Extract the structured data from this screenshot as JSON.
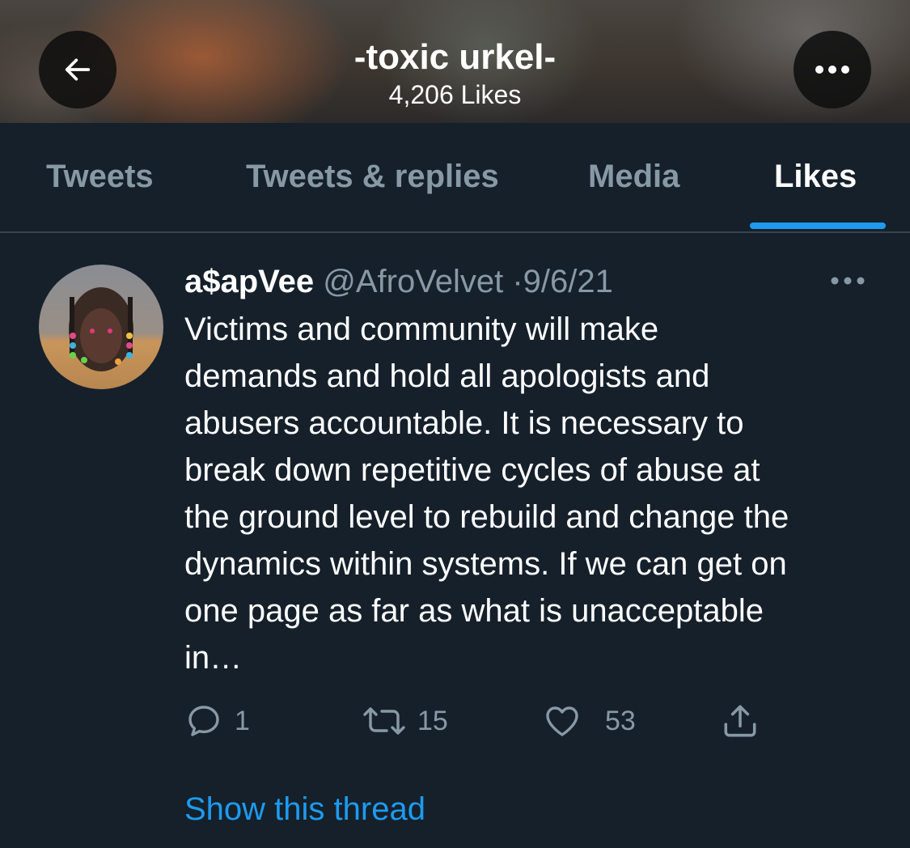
{
  "header": {
    "title": "-toxic urkel-",
    "subtitle": "4,206 Likes",
    "back_icon": "arrow-left-icon",
    "more_icon": "more-horizontal-icon"
  },
  "tabs": [
    {
      "label": "Tweets",
      "active": false
    },
    {
      "label": "Tweets & replies",
      "active": false
    },
    {
      "label": "Media",
      "active": false
    },
    {
      "label": "Likes",
      "active": true
    }
  ],
  "tweet": {
    "author_name": "a$apVee",
    "author_handle": "@AfroVelvet",
    "separator": "·",
    "date": "9/6/21",
    "text": "Victims and community will make\ndemands and hold all apologists and\nabusers accountable. It is necessary to\nbreak down repetitive cycles of abuse at\nthe ground level to rebuild and change the\ndynamics within systems. If we can get on\none page as far as what is unacceptable\nin…",
    "replies": "1",
    "retweets": "15",
    "likes": "53",
    "show_thread": "Show this thread"
  },
  "colors": {
    "background": "#15202b",
    "muted_text": "#8899a6",
    "accent": "#1d9bf0",
    "divider": "#38444d"
  }
}
